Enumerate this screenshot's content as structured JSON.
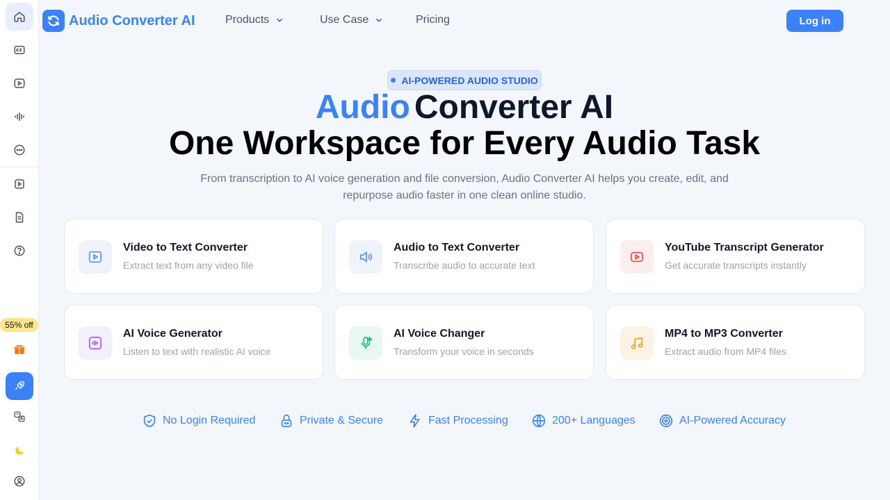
{
  "sidebar": {
    "discount": "55% off"
  },
  "header": {
    "logo_text": "Audio Converter AI",
    "nav": [
      "Products",
      "Use Case",
      "Pricing"
    ],
    "login": "Log in"
  },
  "hero": {
    "badge": "AI-POWERED AUDIO STUDIO",
    "title_accent": "Audio",
    "title_rest": "Converter AI",
    "title_line2": "One Workspace for Every Audio Task",
    "subtitle": "From transcription to AI voice generation and file conversion, Audio Converter AI helps you create, edit, and repurpose audio faster in one clean online studio."
  },
  "cards": [
    {
      "title": "Video to Text Converter",
      "desc": "Extract text from any video file"
    },
    {
      "title": "Audio to Text Converter",
      "desc": "Transcribe audio to accurate text"
    },
    {
      "title": "YouTube Transcript Generator",
      "desc": "Get accurate transcripts instantly"
    },
    {
      "title": "AI Voice Generator",
      "desc": "Listen to text with realistic AI voice"
    },
    {
      "title": "AI Voice Changer",
      "desc": "Transform your voice in seconds"
    },
    {
      "title": "MP4 to MP3 Converter",
      "desc": "Extract audio from MP4 files"
    }
  ],
  "features": [
    "No Login Required",
    "Private & Secure",
    "Fast Processing",
    "200+ Languages",
    "AI-Powered Accuracy"
  ],
  "colors": {
    "accent": "#3b82f6",
    "background": "#f3f6fb"
  }
}
